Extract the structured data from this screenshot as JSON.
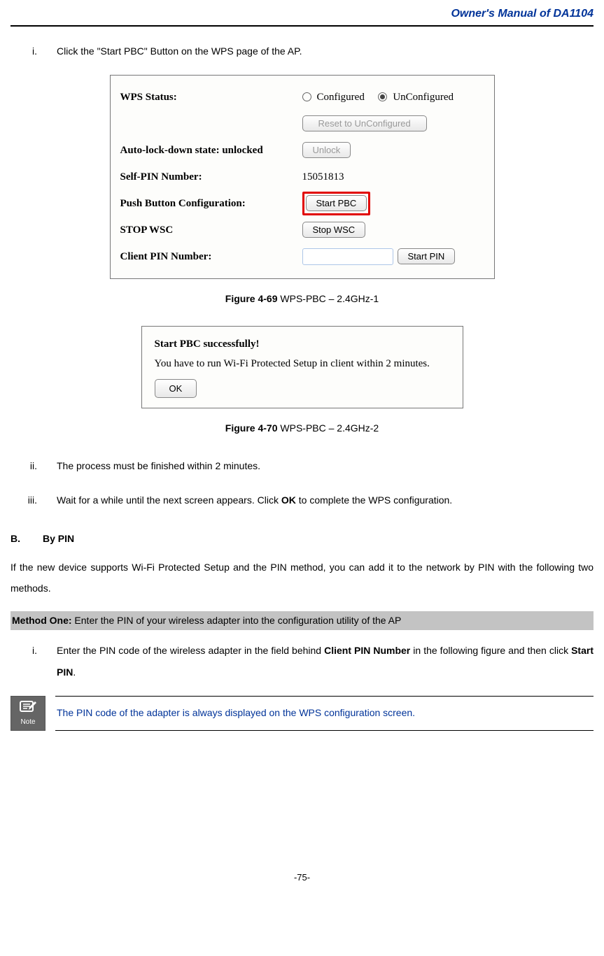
{
  "header": {
    "title": "Owner's Manual of DA1104"
  },
  "step_i": {
    "num": "i.",
    "text_1": "Click the \"Start PBC\" Button on the WPS page of the AP."
  },
  "wps_panel": {
    "status_label": "WPS Status:",
    "configured": "Configured",
    "unconfigured": "UnConfigured",
    "reset_btn": "Reset to UnConfigured",
    "auto_lock_label": "Auto-lock-down state: unlocked",
    "unlock_btn": "Unlock",
    "self_pin_label": "Self-PIN Number:",
    "self_pin_value": "15051813",
    "pbc_label": "Push Button Configuration:",
    "start_pbc_btn": "Start PBC",
    "stop_wsc_label": "STOP WSC",
    "stop_wsc_btn": "Stop WSC",
    "client_pin_label": "Client PIN Number:",
    "start_pin_btn": "Start PIN"
  },
  "caption1": {
    "bold": "Figure 4-69",
    "rest": " WPS-PBC – 2.4GHz-1"
  },
  "dialog": {
    "line1": "Start PBC successfully!",
    "line2": "You have to run Wi-Fi Protected Setup in client within 2 minutes.",
    "ok_btn": "OK"
  },
  "caption2": {
    "bold": "Figure 4-70",
    "rest": " WPS-PBC – 2.4GHz-2"
  },
  "step_ii": {
    "num": "ii.",
    "text": "The process must be finished within 2 minutes."
  },
  "step_iii": {
    "num": "iii.",
    "text_before": "Wait for a while until the next screen appears. Click ",
    "ok": "OK",
    "text_after": " to complete the WPS configuration."
  },
  "section_b": {
    "letter": "B.",
    "title": "By PIN"
  },
  "para_b": "If the new device supports Wi-Fi Protected Setup and the PIN method, you can add it to the network by PIN with the following two methods.",
  "method_one": {
    "bold": "Method One:",
    "rest": " Enter the PIN of your wireless adapter into the configuration utility of the AP"
  },
  "pin_step_i": {
    "num": "i.",
    "t1": "Enter the PIN code of the wireless adapter in the field behind ",
    "b1": "Client PIN Number",
    "t2": " in the following figure and then click ",
    "b2": "Start PIN",
    "t3": "."
  },
  "note": {
    "icon_label": "Note",
    "text": "The PIN code of the adapter is always displayed on the WPS configuration screen."
  },
  "page_num": "-75-"
}
